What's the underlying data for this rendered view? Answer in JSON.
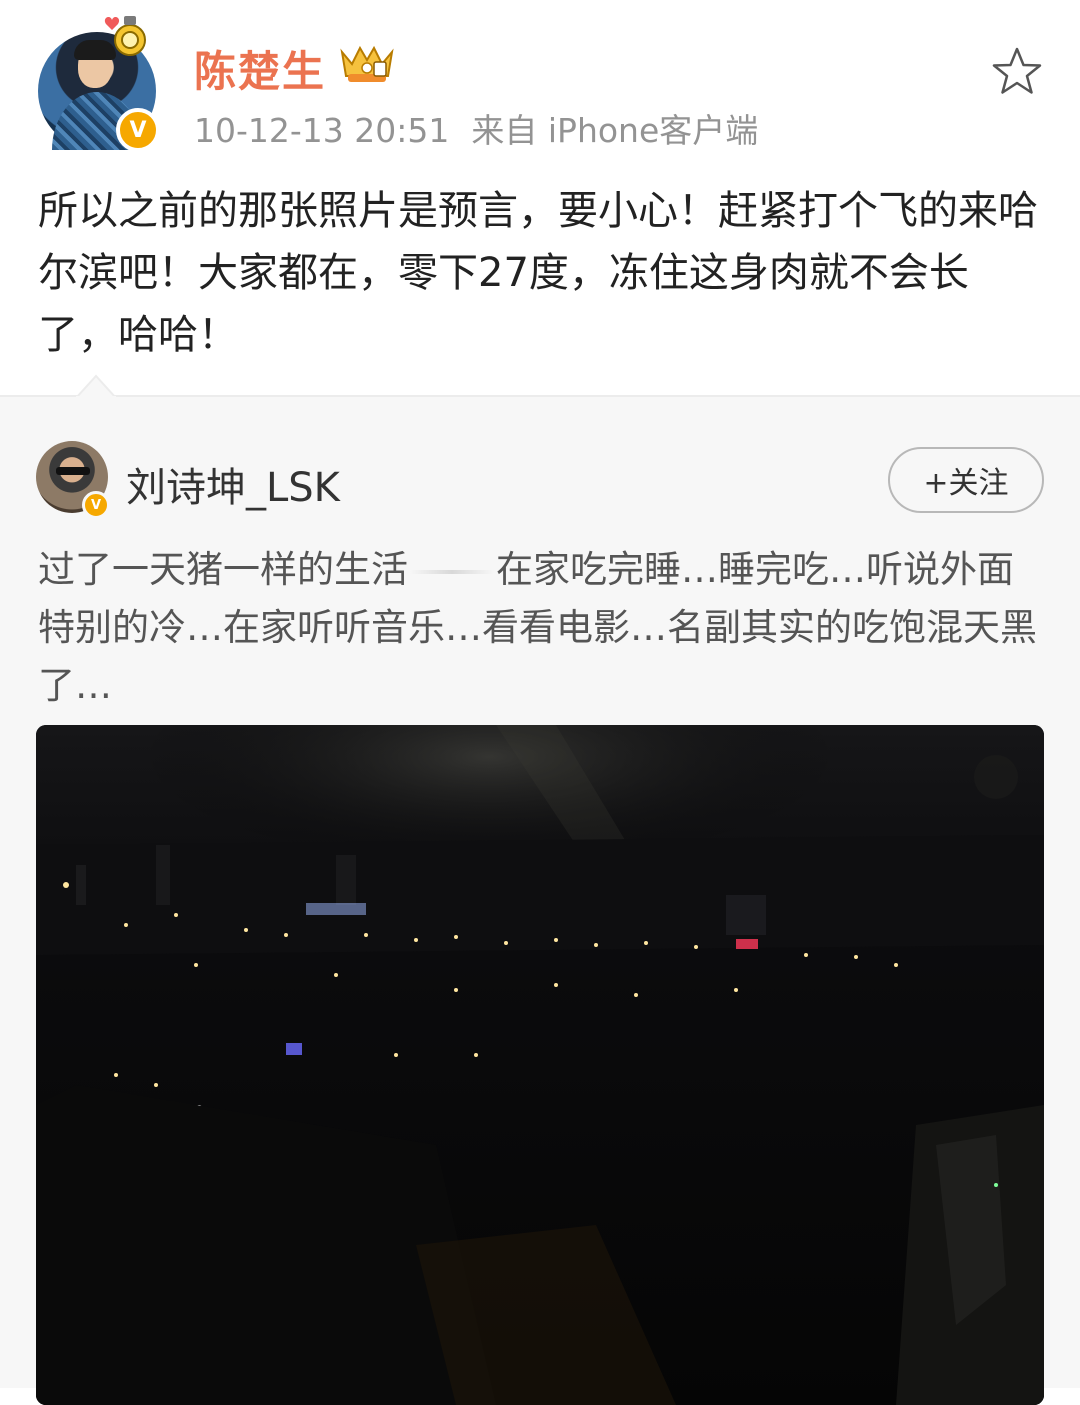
{
  "post": {
    "username": "陈楚生",
    "verified_badge": "V",
    "timestamp": "10-12-13 20:51",
    "source": "来自 iPhone客户端",
    "text": "所以之前的那张照片是预言，要小心！赶紧打个飞的来哈尔滨吧！大家都在，零下27度，冻住这身肉就不会长了，哈哈！",
    "icons": [
      "avatar",
      "medal-icon",
      "crown-badge-icon",
      "star-icon",
      "verified-icon"
    ]
  },
  "repost": {
    "username": "刘诗坤_LSK",
    "verified_badge": "V",
    "follow_label": "+关注",
    "text_part1": "过了一天猪一样的生活",
    "text_part2": "在家吃完睡…睡完吃…听说外面特别的冷…在家听听音乐…看看电影…名副其实的吃饱混天黑了…",
    "image": "night-city-photo"
  },
  "colors": {
    "username": "#eb7350",
    "meta": "#939393",
    "repost_bg": "#f7f7f7",
    "badge": "#f6a800"
  }
}
